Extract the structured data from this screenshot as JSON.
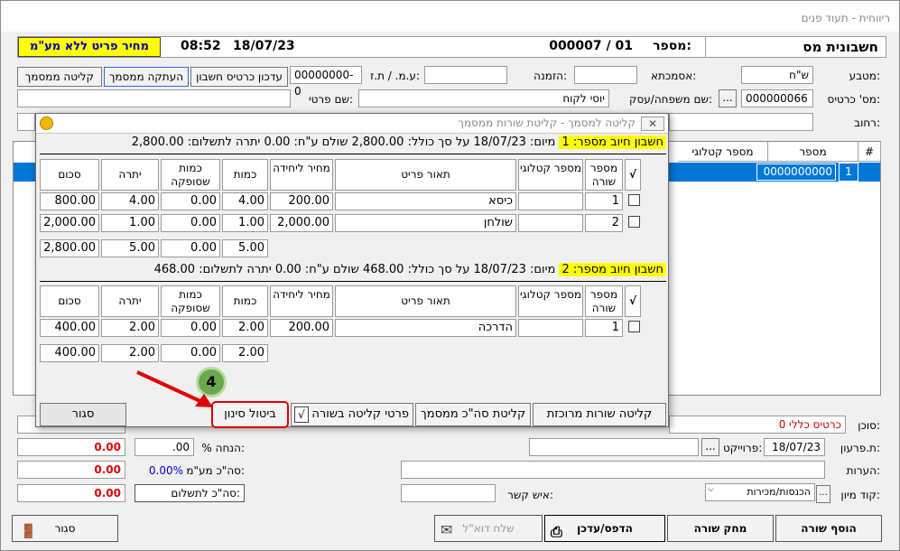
{
  "window": {
    "title": "ריווחית - תעוד פנים"
  },
  "header": {
    "title": "חשבונית מס",
    "number_label": "מספר:",
    "number_value": "000007 / 01",
    "date": "18/07/23",
    "time": "08:52",
    "price_mode": "מחיר פריט ללא מע\"מ"
  },
  "form": {
    "currency_label": "מטבע:",
    "currency_value": "ש\"ח",
    "reference_label": "אסמכתא:",
    "reference_value": "",
    "order_label": "הזמנה:",
    "order_value": "",
    "vat_id_label": "ע.מ. / ת.ז:",
    "vat_id_value": "00000000-0",
    "card_no_label": "מס' כרטיס:",
    "card_no_value": "000000066",
    "family_label": "שם משפחה/עסק:",
    "family_value": "יוסי לקוח",
    "first_name_label": "שם פרטי:",
    "first_name_value": "",
    "street_label": "רחוב:",
    "street_value": "",
    "btn_update_card": "עדכון כרטיס חשבון",
    "btn_copy_doc": "העתקה ממסמך",
    "btn_import_doc": "קליטה ממסמך",
    "ellipsis": "..."
  },
  "grid": {
    "headers": [
      "#",
      "מספר",
      "מספר קטלוגי"
    ],
    "row": {
      "num": "1",
      "code": "0000000000"
    }
  },
  "dialog": {
    "title": "קליטה למסמך - קליטת שורות ממסמך",
    "sections": [
      {
        "title": "חשבון חיוב מספר: 1",
        "summary": " מיום: 18/07/23 על סך כולל: 2,800.00 שולם ע\"ח: 0.00 יתרה לתשלום: 2,800.00",
        "headers": {
          "check": "√",
          "line": "מספר שורה",
          "catalog": "מספר קטלוגי",
          "desc": "תאור פריט",
          "price": "מחיר ליחידה",
          "qty": "כמות",
          "supplied": "כמות שסופקה",
          "balance": "יתרה",
          "total": "סכום"
        },
        "rows": [
          {
            "line": "1",
            "catalog": "",
            "desc": "כיסא",
            "price": "200.00",
            "qty": "4.00",
            "supplied": "0.00",
            "balance": "4.00",
            "total": "800.00"
          },
          {
            "line": "2",
            "catalog": "",
            "desc": "שולחן",
            "price": "2,000.00",
            "qty": "1.00",
            "supplied": "0.00",
            "balance": "1.00",
            "total": "2,000.00"
          }
        ],
        "totals": {
          "qty": "5.00",
          "supplied": "0.00",
          "balance": "5.00",
          "total": "2,800.00"
        }
      },
      {
        "title": "חשבון חיוב מספר: 2",
        "summary": " מיום: 18/07/23 על סך כולל: 468.00 שולם ע\"ח: 0.00 יתרה לתשלום: 468.00",
        "headers": {
          "check": "√",
          "line": "מספר שורה",
          "catalog": "מספר קטלוגי",
          "desc": "תאור פריט",
          "price": "מחיר ליחידה",
          "qty": "כמות",
          "supplied": "כמות שסופקה",
          "balance": "יתרה",
          "total": "סכום"
        },
        "rows": [
          {
            "line": "1",
            "catalog": "",
            "desc": "הדרכה",
            "price": "200.00",
            "qty": "2.00",
            "supplied": "0.00",
            "balance": "2.00",
            "total": "400.00"
          }
        ],
        "totals": {
          "qty": "2.00",
          "supplied": "0.00",
          "balance": "2.00",
          "total": "400.00"
        }
      }
    ],
    "btn_import_bulk": "קליטה שורות מרוכזת",
    "btn_import_total": "קליטת סה\"כ ממסמך",
    "chk_line_details": "פרטי קליטה בשורה",
    "chk_line_details_mark": "√",
    "btn_cancel_filter": "ביטול סינון",
    "btn_close": "סגור",
    "annotation_step": "4"
  },
  "footer": {
    "agent_label": "סוכן:",
    "agent_value": "כרטיס כללי 0",
    "due_label": "ת.פרעון:",
    "due_value": "18/07/23",
    "project_label": "פרוייקט:",
    "project_value": "",
    "notes_label": "הערות:",
    "notes_value": "",
    "contact_label": "איש קשר:",
    "contact_value": "",
    "sort_label": "קוד מיון:",
    "sort_value": "הכנסות/מכירות",
    "discount_label": "% הנחה:",
    "discount_value": ".00",
    "vat_total_label": "סה\"כ מע\"מ:",
    "vat_total_value": "0.00%",
    "pay_total_label": "סה\"כ לתשלום:",
    "amount1": "0.00",
    "amount2": "0.00",
    "amount3": "0.00",
    "btn_add_line": "הוסף שורה",
    "btn_delete_line": "מחק שורה",
    "btn_print": "הדפס/עדכן",
    "btn_email": "שלח דוא\"ל",
    "btn_close": "סגור"
  },
  "colors": {
    "highlight": "#ffff00",
    "selection": "#0078d7",
    "annotation_red": "#e00000",
    "annotation_badge": "#6aa84f"
  }
}
